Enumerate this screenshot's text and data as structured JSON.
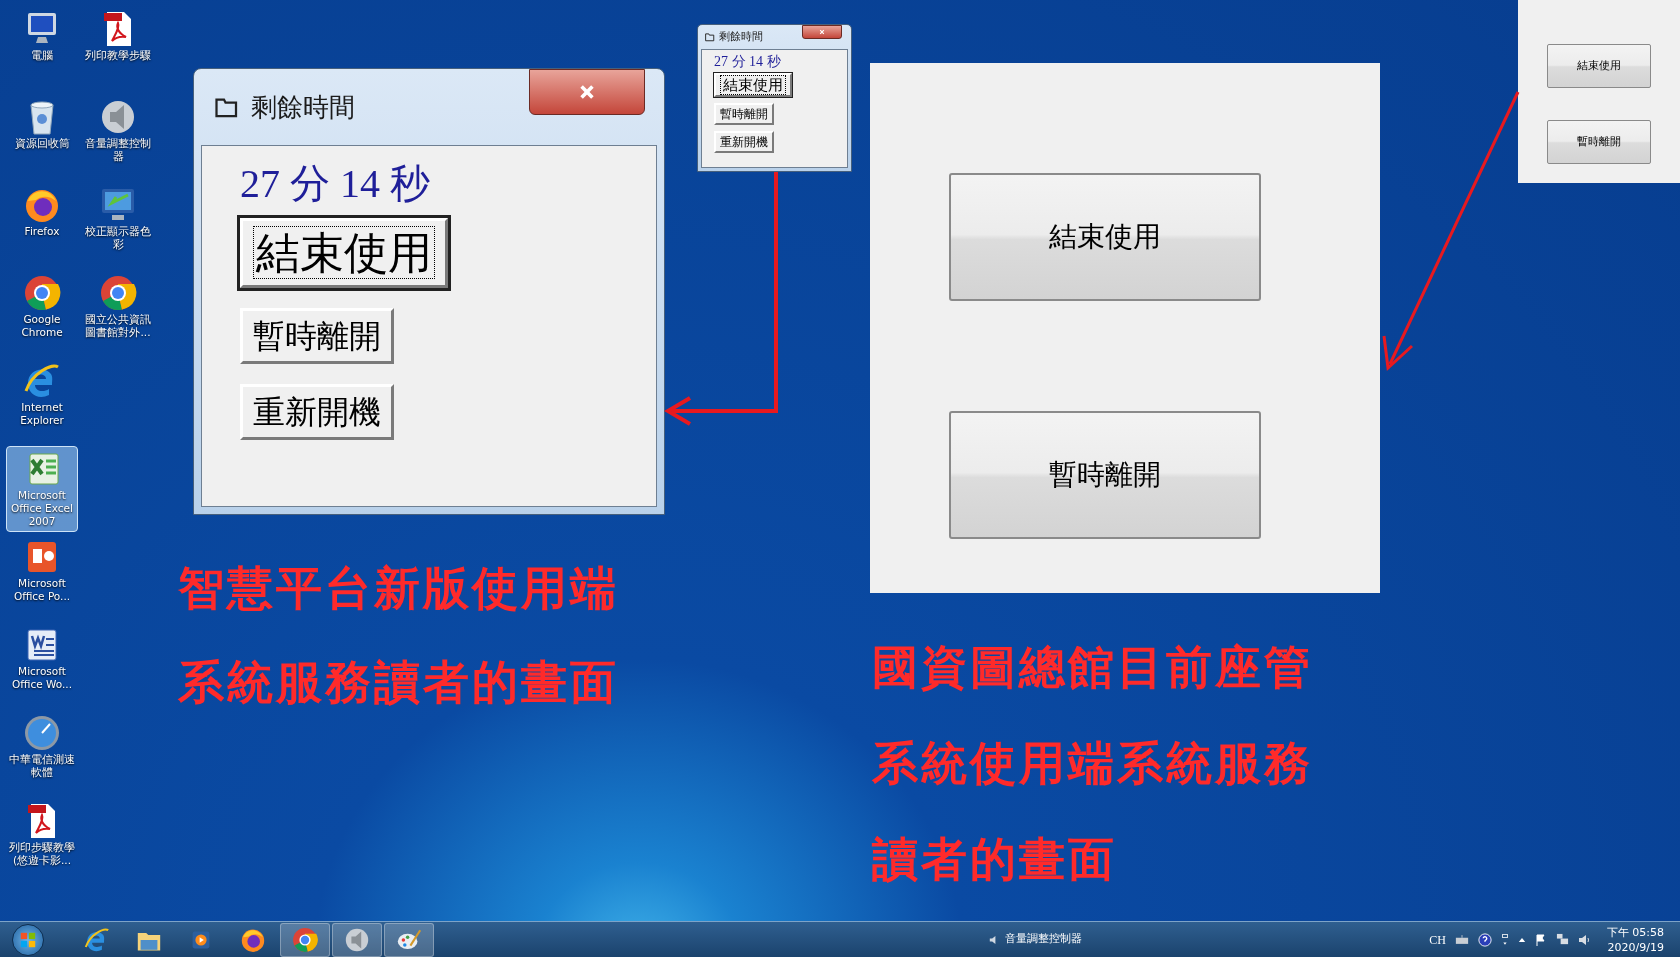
{
  "desktop_icons": [
    {
      "kind": "computer",
      "label": "電腦",
      "selected": false
    },
    {
      "kind": "pdf",
      "label": "列印教學步驟",
      "selected": false
    },
    {
      "kind": "recycle",
      "label": "資源回收筒",
      "selected": false
    },
    {
      "kind": "speaker",
      "label": "音量調整控制器",
      "selected": false
    },
    {
      "kind": "firefox",
      "label": "Firefox",
      "selected": false
    },
    {
      "kind": "display",
      "label": "校正顯示器色彩",
      "selected": false
    },
    {
      "kind": "chrome",
      "label": "Google Chrome",
      "selected": false
    },
    {
      "kind": "chrome",
      "label": "國立公共資訊圖書館對外...",
      "selected": false
    },
    {
      "kind": "ie",
      "label": "Internet Explorer",
      "selected": false
    },
    {
      "kind": "excel",
      "label": "Microsoft Office Excel 2007",
      "selected": true
    },
    {
      "kind": "powerpoint",
      "label": "Microsoft Office Po...",
      "selected": false
    },
    {
      "kind": "word",
      "label": "Microsoft Office Wo...",
      "selected": false
    },
    {
      "kind": "gauge",
      "label": "中華電信測速軟體",
      "selected": false
    },
    {
      "kind": "pdf",
      "label": "列印步驟教學(悠遊卡影...",
      "selected": false
    }
  ],
  "timer_window_large": {
    "title": "剩餘時間",
    "time": "27 分 14 秒",
    "buttons": [
      {
        "label": "結束使用",
        "focused": true
      },
      {
        "label": "暫時離開",
        "focused": false
      },
      {
        "label": "重新開機",
        "focused": false
      }
    ]
  },
  "timer_window_small": {
    "title": "剩餘時間",
    "time": "27 分 14 秒",
    "buttons": [
      {
        "label": "結束使用",
        "focused": true
      },
      {
        "label": "暫時離開",
        "focused": false
      },
      {
        "label": "重新開機",
        "focused": false
      }
    ]
  },
  "old_panel_large": {
    "buttons": [
      "結束使用",
      "暫時離開"
    ]
  },
  "old_panel_small": {
    "buttons": [
      "結束使用",
      "暫時離開"
    ]
  },
  "captions": [
    {
      "lines": [
        "智慧平台新版使用端",
        "系統服務讀者的畫面"
      ]
    },
    {
      "lines": [
        "國資圖總館目前座管",
        "系統使用端系統服務",
        "讀者的畫面"
      ]
    }
  ],
  "taskbar": {
    "apps": [
      {
        "kind": "ie",
        "active": false
      },
      {
        "kind": "folder",
        "active": false
      },
      {
        "kind": "media",
        "active": false
      },
      {
        "kind": "firefox",
        "active": false
      },
      {
        "kind": "chrome",
        "active": true
      },
      {
        "kind": "speaker",
        "active": true
      },
      {
        "kind": "paint",
        "active": true
      }
    ],
    "toolbar_label": "音量調整控制器",
    "language": "CH",
    "time": "下午 05:58",
    "date": "2020/9/19"
  }
}
